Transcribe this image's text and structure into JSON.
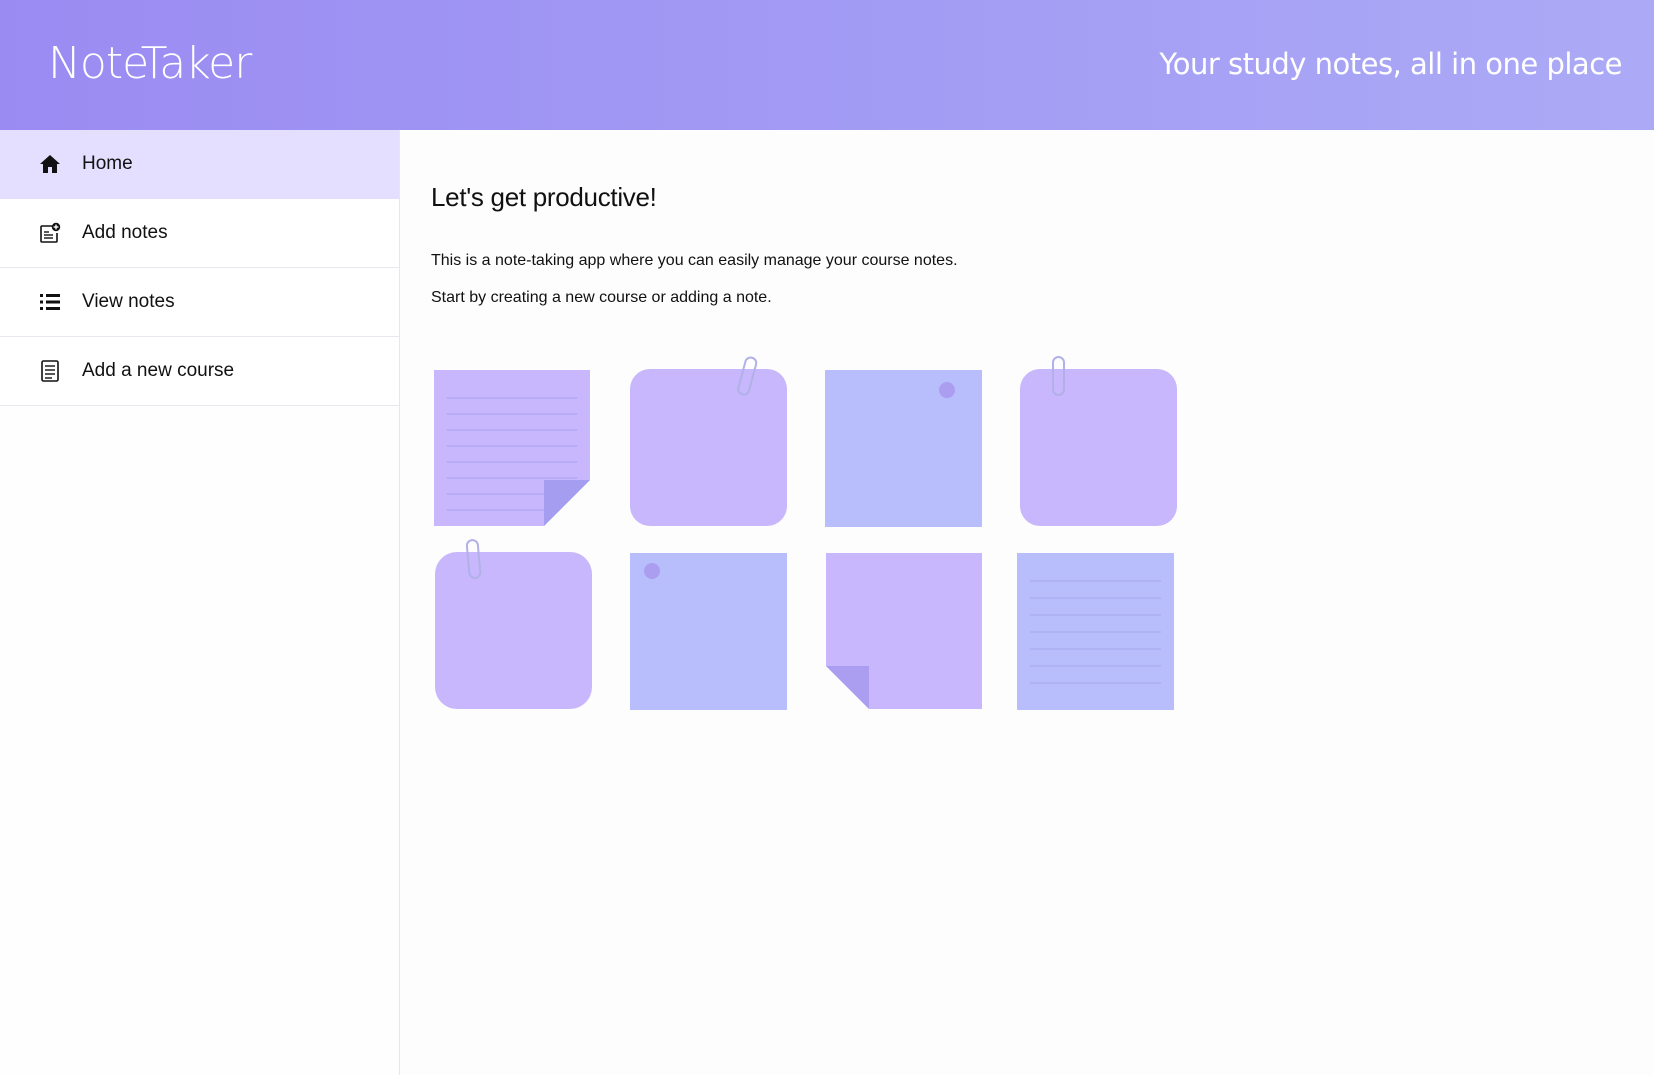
{
  "header": {
    "app_title": "NoteTaker",
    "tagline": "Your study notes, all in one place"
  },
  "sidebar": {
    "items": [
      {
        "label": "Home",
        "icon": "home-icon",
        "active": true
      },
      {
        "label": "Add notes",
        "icon": "add-note-icon",
        "active": false
      },
      {
        "label": "View notes",
        "icon": "list-icon",
        "active": false
      },
      {
        "label": "Add a new course",
        "icon": "document-icon",
        "active": false
      }
    ]
  },
  "main": {
    "heading": "Let's get productive!",
    "paragraphs": [
      "This is a note-taking app where you can easily manage your course notes.",
      "Start by creating a new course or adding a note."
    ],
    "notes": [
      {
        "style": "lined-folded-corner",
        "color": "#c8b7fc"
      },
      {
        "style": "rounded-paperclip",
        "color": "#c8b7fc"
      },
      {
        "style": "pinned",
        "color": "#b8befc"
      },
      {
        "style": "rounded-paperclip",
        "color": "#c8b7fc"
      },
      {
        "style": "rounded-paperclip",
        "color": "#c8b7fc"
      },
      {
        "style": "pinned",
        "color": "#b8befc"
      },
      {
        "style": "folded-corner",
        "color": "#c8b7fc"
      },
      {
        "style": "lined",
        "color": "#b8befc"
      }
    ]
  },
  "colors": {
    "header_start": "#9a8bf2",
    "header_end": "#acaaf6",
    "active_nav": "#e4dfff",
    "note_purple": "#c8b7fc",
    "note_blue": "#b8befc"
  }
}
